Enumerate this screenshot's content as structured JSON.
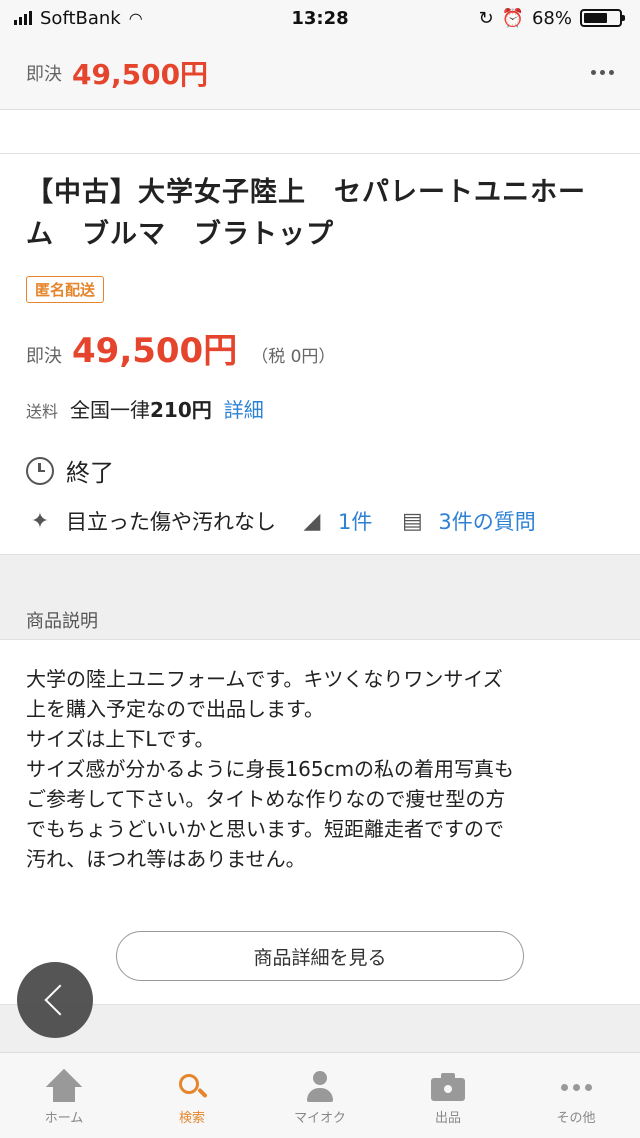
{
  "status_bar": {
    "carrier": "SoftBank",
    "time": "13:28",
    "battery": "68%",
    "battery_level": 0.68
  },
  "header": {
    "price_label": "即決",
    "price": "49,500円"
  },
  "product": {
    "title_line1": "【中古】大学女子陸上　セパレートユニホー",
    "title_line2": "ム　ブルマ　ブラトップ",
    "badge": "匿名配送",
    "price_label": "即決",
    "price": "49,500円",
    "tax": "（税 0円）",
    "shipping_label": "送料",
    "shipping_prefix": "全国一律",
    "shipping_price": "210円",
    "shipping_detail": "詳細",
    "status": "終了",
    "condition": "目立った傷や汚れなし",
    "bids": "1件",
    "questions": "3件の質問"
  },
  "description": {
    "section_title": "商品説明",
    "lines": [
      "大学の陸上ユニフォームです。キツくなりワンサイズ",
      "上を購入予定なので出品します。",
      "サイズは上下Lです。",
      "サイズ感が分かるように身長165cmの私の着用写真も",
      "ご参考して下さい。タイトめな作りなので痩せ型の方",
      "でもちょうどいいかと思います。短距離走者ですので",
      "汚れ、ほつれ等はありません。"
    ],
    "detail_button": "商品詳細を見る"
  },
  "tabbar": {
    "items": [
      {
        "label": "ホーム",
        "icon": "home-icon"
      },
      {
        "label": "検索",
        "icon": "search-icon",
        "active": true
      },
      {
        "label": "マイオク",
        "icon": "person-icon"
      },
      {
        "label": "出品",
        "icon": "camera-icon"
      },
      {
        "label": "その他",
        "icon": "more-icon"
      }
    ]
  },
  "colors": {
    "price_red": "#e5452d",
    "accent_orange": "#e5862d",
    "link_blue": "#2e82d4"
  }
}
